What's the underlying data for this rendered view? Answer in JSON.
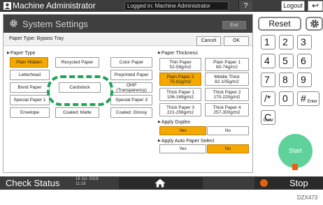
{
  "topbar": {
    "title": "Machine Administrator",
    "login_status": "Logged in: Machine Administrator",
    "help_icon": "?",
    "logout_label": "Logout",
    "back_icon": "back-arrow-icon"
  },
  "panel": {
    "title": "System Settings",
    "exit_label": "Exit",
    "subtitle": "Paper Type: Bypass Tray",
    "cancel_label": "Cancel",
    "ok_label": "OK"
  },
  "paper_type": {
    "label": "Paper Type",
    "buttons": [
      {
        "label": "Plain Hidden",
        "selected": true
      },
      {
        "label": "Recycled Paper",
        "selected": false
      },
      {
        "label": "Color Paper",
        "selected": false
      },
      {
        "label": "Letterhead",
        "selected": false
      },
      {
        "label": "Preprinted Paper",
        "selected": false
      },
      {
        "label": "Bond Paper",
        "selected": false
      },
      {
        "label": "Cardstock",
        "selected": false
      },
      {
        "label": "OHP (Transparency)",
        "selected": false
      },
      {
        "label": "Special Paper 1",
        "selected": false
      },
      {
        "label": "Special Paper 3",
        "selected": false
      },
      {
        "label": "Envelope",
        "selected": false
      },
      {
        "label": "Coated: Matte",
        "selected": false
      },
      {
        "label": "Coated: Glossy",
        "selected": false
      }
    ]
  },
  "paper_thickness": {
    "label": "Paper Thickness",
    "buttons": [
      {
        "line1": "Thin Paper",
        "line2": "52-59g/m2",
        "selected": false
      },
      {
        "line1": "Plain Paper 1",
        "line2": "60-74g/m2",
        "selected": false
      },
      {
        "line1": "Plain Paper 2",
        "line2": "75-81g/m2",
        "selected": true
      },
      {
        "line1": "Middle Thick",
        "line2": "82-105g/m2",
        "selected": false
      },
      {
        "line1": "Thick Paper 1",
        "line2": "106-169g/m2",
        "selected": false
      },
      {
        "line1": "Thick Paper 2",
        "line2": "170-220g/m2",
        "selected": false
      },
      {
        "line1": "Thick Paper 3",
        "line2": "221-256g/m2",
        "selected": false
      },
      {
        "line1": "Thick Paper 4",
        "line2": "257-300g/m2",
        "selected": false
      }
    ]
  },
  "apply_duplex": {
    "label": "Apply Duplex",
    "yes_label": "Yes",
    "no_label": "No",
    "selected": "Yes"
  },
  "apply_auto_paper": {
    "label": "Apply Auto Paper Select",
    "yes_label": "Yes",
    "no_label": "No",
    "selected": "No"
  },
  "keypad": {
    "reset_label": "Reset",
    "settings_icon": "gear-icon",
    "keys": [
      "1",
      "2",
      "3",
      "4",
      "5",
      "6",
      "7",
      "8",
      "9",
      "/*",
      "0",
      "#"
    ],
    "enter_label": "Enter",
    "clear_label": "C",
    "clear_sub": "Clear",
    "start_label": "Start"
  },
  "bottombar": {
    "check_status_label": "Check Status",
    "date": "18 Jul. 2018",
    "time": "11:18",
    "home_icon": "home-icon",
    "stop_label": "Stop"
  },
  "caption": "DZX473",
  "colors": {
    "selected": "#f5a800",
    "highlight": "#1ea457",
    "start": "#5fd19a",
    "stop": "#e8610a"
  }
}
